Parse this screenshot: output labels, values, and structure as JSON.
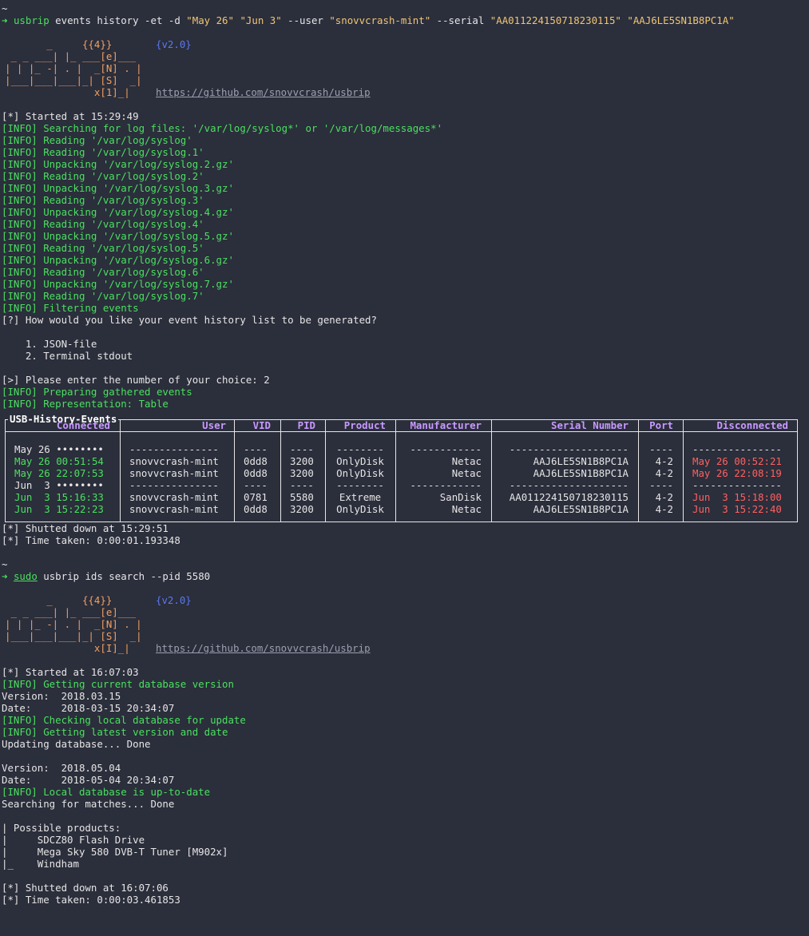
{
  "session1": {
    "prompt": "~",
    "arrow": "➜",
    "cmd_prog": "usbrip",
    "cmd_args": " events history -et -d ",
    "cmd_q1": "\"May 26\"",
    "cmd_q2": "\"Jun 3\"",
    "cmd_user_flag": " --user ",
    "cmd_user": "\"snovvcrash-mint\"",
    "cmd_serial_flag": " --serial ",
    "cmd_serial1": "\"AA011224150718230115\"",
    "cmd_serial2": "\"AAJ6LE5SN1B8PC1A\""
  },
  "banner": {
    "art_line1": "       _     {{4}}",
    "art_line2": " _ _ ___| |_ ___[e]___",
    "art_line3": "| | |_ -| . |  _[N] . |",
    "art_line4": "|___|___|___|_| [S]  _|",
    "art_line5": "               x[1]_|",
    "art_line5b": "               x[I]_|",
    "version": "{v2.0}",
    "url": "https://github.com/snovvcrash/usbrip"
  },
  "log1": {
    "started": "[*] Started at 15:29:49",
    "info": [
      "[INFO] Searching for log files: '/var/log/syslog*' or '/var/log/messages*'",
      "[INFO] Reading '/var/log/syslog'",
      "[INFO] Reading '/var/log/syslog.1'",
      "[INFO] Unpacking '/var/log/syslog.2.gz'",
      "[INFO] Reading '/var/log/syslog.2'",
      "[INFO] Unpacking '/var/log/syslog.3.gz'",
      "[INFO] Reading '/var/log/syslog.3'",
      "[INFO] Unpacking '/var/log/syslog.4.gz'",
      "[INFO] Reading '/var/log/syslog.4'",
      "[INFO] Unpacking '/var/log/syslog.5.gz'",
      "[INFO] Reading '/var/log/syslog.5'",
      "[INFO] Unpacking '/var/log/syslog.6.gz'",
      "[INFO] Reading '/var/log/syslog.6'",
      "[INFO] Unpacking '/var/log/syslog.7.gz'",
      "[INFO] Reading '/var/log/syslog.7'",
      "[INFO] Filtering events"
    ],
    "question": "[?] How would you like your event history list to be generated?",
    "option1": "    1. JSON-file",
    "option2": "    2. Terminal stdout",
    "choice": "[>] Please enter the number of your choice: 2",
    "preparing": "[INFO] Preparing gathered events",
    "representation": "[INFO] Representation: Table"
  },
  "table": {
    "title": "USB-History-Events",
    "headers": [
      "Connected",
      "User",
      "VID",
      "PID",
      "Product",
      "Manufacturer",
      "Serial Number",
      "Port",
      "Disconnected"
    ],
    "rows": [
      [
        "May 26 ••••••••",
        "---------------",
        "----",
        "----",
        "--------",
        "------------",
        "--------------------",
        "----",
        "---------------"
      ],
      [
        "May 26 00:51:54",
        "snovvcrash-mint",
        "0dd8",
        "3200",
        "OnlyDisk",
        "Netac",
        "AAJ6LE5SN1B8PC1A",
        "4-2",
        "May 26 00:52:21"
      ],
      [
        "May 26 22:07:53",
        "snovvcrash-mint",
        "0dd8",
        "3200",
        "OnlyDisk",
        "Netac",
        "AAJ6LE5SN1B8PC1A",
        "4-2",
        "May 26 22:08:19"
      ],
      [
        "Jun  3 ••••••••",
        "---------------",
        "----",
        "----",
        "--------",
        "------------",
        "--------------------",
        "----",
        "---------------"
      ],
      [
        "Jun  3 15:16:33",
        "snovvcrash-mint",
        "0781",
        "5580",
        "Extreme",
        "SanDisk",
        "AA011224150718230115",
        "4-2",
        "Jun  3 15:18:00"
      ],
      [
        "Jun  3 15:22:23",
        "snovvcrash-mint",
        "0dd8",
        "3200",
        "OnlyDisk",
        "Netac",
        "AAJ6LE5SN1B8PC1A",
        "4-2",
        "Jun  3 15:22:40"
      ]
    ]
  },
  "log1_end": {
    "shutdown": "[*] Shutted down at 15:29:51",
    "time_taken": "[*] Time taken: 0:00:01.193348"
  },
  "session2": {
    "prompt": "~",
    "arrow": "➜",
    "sudo": "sudo",
    "cmd": " usbrip ids search --pid 5580"
  },
  "log2": {
    "started": "[*] Started at 16:07:03",
    "getting_version": "[INFO] Getting current database version",
    "version1": "Version:  2018.03.15",
    "date1": "Date:     2018-03-15 20:34:07",
    "checking": "[INFO] Checking local database for update",
    "latest": "[INFO] Getting latest version and date",
    "updating": "Updating database... Done",
    "version2": "Version:  2018.05.04",
    "date2": "Date:     2018-05-04 20:34:07",
    "uptodate": "[INFO] Local database is up-to-date",
    "searching": "Searching for matches... Done",
    "possible": "| Possible products:",
    "p1": "|     SDCZ80 Flash Drive",
    "p2": "|     Mega Sky 580 DVB-T Tuner [M902x]",
    "p3": "|_    Windham",
    "shutdown": "[*] Shutted down at 16:07:06",
    "time_taken": "[*] Time taken: 0:00:03.461853"
  },
  "colors": {
    "background": "#2b2e3b",
    "info_green": "#4ae060",
    "string_yellow": "#f0c674",
    "header_purple": "#c899ff",
    "disconnect_red": "#ff6060"
  }
}
